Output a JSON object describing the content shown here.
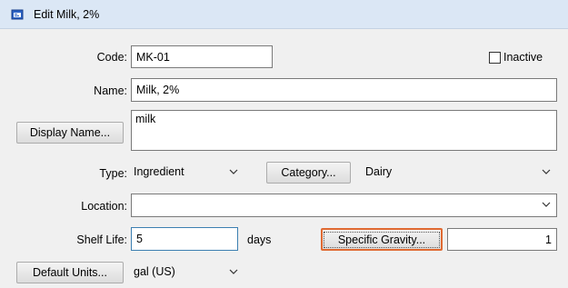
{
  "window": {
    "title": "Edit Milk, 2%",
    "icon": "window-icon"
  },
  "code": {
    "label": "Code:",
    "value": "MK-01"
  },
  "inactive": {
    "label": "Inactive",
    "checked": false
  },
  "name": {
    "label": "Name:",
    "value": "Milk, 2%"
  },
  "display_name": {
    "button_label": "Display Name...",
    "value": "milk"
  },
  "type": {
    "label": "Type:",
    "value": "Ingredient"
  },
  "category": {
    "button_label": "Category...",
    "value": "Dairy"
  },
  "location": {
    "label": "Location:",
    "value": ""
  },
  "shelf_life": {
    "label": "Shelf Life:",
    "value": "5",
    "unit": "days"
  },
  "specific_gravity": {
    "button_label": "Specific Gravity...",
    "value": "1"
  },
  "default_units": {
    "button_label": "Default Units...",
    "value": "gal (US)"
  },
  "colors": {
    "titlebar": "#dbe7f5",
    "focus_border": "#e06a32",
    "input_focus_border": "#3c7fb1"
  }
}
